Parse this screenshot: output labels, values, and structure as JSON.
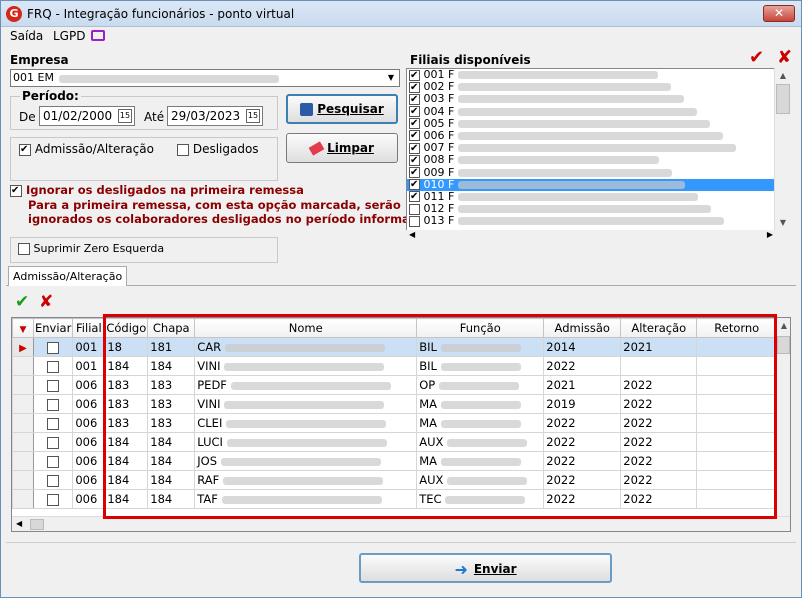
{
  "window": {
    "title": "FRQ - Integração funcionários - ponto virtual",
    "logo": "G",
    "close": "✕"
  },
  "menu": {
    "saida": "Saída",
    "lgpd": "LGPD"
  },
  "empresa": {
    "label": "Empresa",
    "value": "001 EM"
  },
  "periodo": {
    "label": "Período:",
    "de_label": "De",
    "de_value": "01/02/2000",
    "ate_label": "Até",
    "ate_value": "29/03/2023"
  },
  "buttons": {
    "pesquisar": "Pesquisar",
    "limpar": "Limpar",
    "enviar": "Enviar"
  },
  "options": {
    "admissao": "Admissão/Alteração",
    "desligados": "Desligados",
    "ignorar": "Ignorar os desligados na primeira remessa",
    "suprimir": "Suprimir Zero Esquerda"
  },
  "note": {
    "line1": "Para a primeira remessa, com esta opção marcada, serão",
    "line2": "ignorados os colaboradores desligados no período informado."
  },
  "filiais": {
    "label": "Filiais disponíveis",
    "items": [
      {
        "code": "001 F",
        "checked": true,
        "selected": false
      },
      {
        "code": "002 F",
        "checked": true,
        "selected": false
      },
      {
        "code": "003 F",
        "checked": true,
        "selected": false
      },
      {
        "code": "004 F",
        "checked": true,
        "selected": false
      },
      {
        "code": "005 F",
        "checked": true,
        "selected": false
      },
      {
        "code": "006 F",
        "checked": true,
        "selected": false
      },
      {
        "code": "007 F",
        "checked": true,
        "selected": false
      },
      {
        "code": "008 F",
        "checked": true,
        "selected": false
      },
      {
        "code": "009 F",
        "checked": true,
        "selected": false
      },
      {
        "code": "010 F",
        "checked": true,
        "selected": true
      },
      {
        "code": "011 F",
        "checked": true,
        "selected": false
      },
      {
        "code": "012 F",
        "checked": false,
        "selected": false
      },
      {
        "code": "013 F",
        "checked": false,
        "selected": false
      }
    ]
  },
  "tab": {
    "label": "Admissão/Alteração"
  },
  "grid": {
    "columns": [
      "Enviar",
      "Filial",
      "Código",
      "Chapa",
      "Nome",
      "Função",
      "Admissão",
      "Alteração",
      "Retorno"
    ],
    "rows": [
      {
        "filial": "001",
        "codigo": "18",
        "chapa": "181",
        "nome": "CAR",
        "funcao": "BIL",
        "admissao": "2014",
        "alteracao": "2021",
        "retorno": ""
      },
      {
        "filial": "001",
        "codigo": "184",
        "chapa": "184",
        "nome": "VINI",
        "funcao": "BIL",
        "admissao": "2022",
        "alteracao": "",
        "retorno": ""
      },
      {
        "filial": "006",
        "codigo": "183",
        "chapa": "183",
        "nome": "PEDF",
        "funcao": "OP",
        "admissao": "2021",
        "alteracao": "2022",
        "retorno": ""
      },
      {
        "filial": "006",
        "codigo": "183",
        "chapa": "183",
        "nome": "VINI",
        "funcao": "MA",
        "admissao": "2019",
        "alteracao": "2022",
        "retorno": ""
      },
      {
        "filial": "006",
        "codigo": "183",
        "chapa": "183",
        "nome": "CLEI",
        "funcao": "MA",
        "admissao": "2022",
        "alteracao": "2022",
        "retorno": ""
      },
      {
        "filial": "006",
        "codigo": "184",
        "chapa": "184",
        "nome": "LUCI",
        "funcao": "AUX",
        "admissao": "2022",
        "alteracao": "2022",
        "retorno": ""
      },
      {
        "filial": "006",
        "codigo": "184",
        "chapa": "184",
        "nome": "JOS",
        "funcao": "MA",
        "admissao": "2022",
        "alteracao": "2022",
        "retorno": ""
      },
      {
        "filial": "006",
        "codigo": "184",
        "chapa": "184",
        "nome": "RAF",
        "funcao": "AUX",
        "admissao": "2022",
        "alteracao": "2022",
        "retorno": ""
      },
      {
        "filial": "006",
        "codigo": "184",
        "chapa": "184",
        "nome": "TAF",
        "funcao": "TEC",
        "admissao": "2022",
        "alteracao": "2022",
        "retorno": ""
      }
    ]
  }
}
